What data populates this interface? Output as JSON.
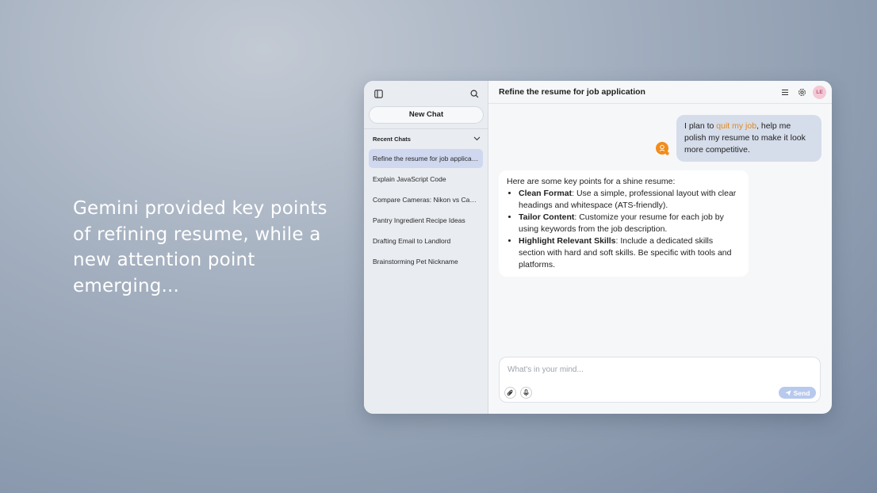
{
  "caption": "Gemini provided key points of refining resume, while a new attention point emerging...",
  "sidebar": {
    "new_chat_label": "New Chat",
    "recent_label": "Recent Chats",
    "items": [
      {
        "label": "Refine the resume for job application",
        "active": true
      },
      {
        "label": "Explain JavaScript Code"
      },
      {
        "label": "Compare Cameras: Nikon vs Canon"
      },
      {
        "label": "Pantry Ingredient Recipe Ideas"
      },
      {
        "label": "Drafting Email to Landlord"
      },
      {
        "label": "Brainstorming Pet Nickname"
      }
    ]
  },
  "header": {
    "title": "Refine the resume for job application",
    "avatar_initials": "LE"
  },
  "conversation": {
    "user_message": {
      "before": "I plan to ",
      "highlight": "quit my job",
      "after": ", help me polish my resume to make it look more competitive."
    },
    "bot_message": {
      "intro": "Here are some key points for a shine resume:",
      "points": [
        {
          "title": "Clean Format",
          "text": ": Use a simple, professional layout with clear headings and whitespace (ATS-friendly)."
        },
        {
          "title": "Tailor Content",
          "text": ": Customize your resume for each job by using keywords from the job description."
        },
        {
          "title": "Highlight Relevant Skills",
          "text": ": Include a dedicated skills section with hard and soft skills. Be specific with tools and platforms."
        }
      ]
    }
  },
  "composer": {
    "placeholder": "What's in your mind...",
    "send_label": "Send"
  },
  "colors": {
    "highlight": "#e08a1e",
    "active_chat": "#cfd8ef",
    "send_button": "#b8c9ee",
    "bot_badge": "#f28c1c"
  }
}
